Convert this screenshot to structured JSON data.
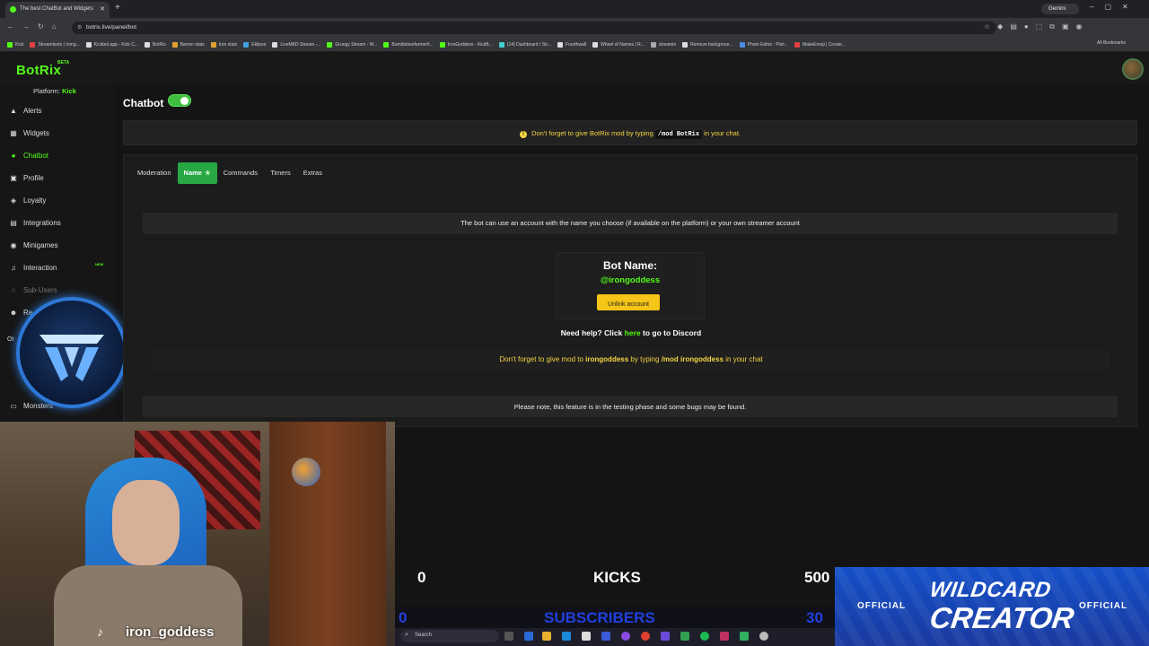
{
  "browser": {
    "tab_title": "The best ChatBot and Widgets",
    "url": "botrix.live/panel/bot",
    "gemini_label": "Gemini",
    "all_bookmarks": "All Bookmarks",
    "bookmarks": [
      "Kick",
      "Streamloots | Irong...",
      "Kickbot.app - Kick C...",
      "BotRix",
      "Barren stats",
      "Iron stats",
      "Eklipse",
      "LiveMKD Stream -...",
      "Grungy Stream - W...",
      "Bumblebeefarmerfi...",
      "IronGoddess - KickB...",
      "(14) Dashboard / Str...",
      "Fourthwall",
      "Wheel of Names | R...",
      "streamin",
      "Remove backgroun...",
      "Photo Editor : Pixlr...",
      "MakeEmoji | Create..."
    ]
  },
  "app": {
    "logo": "BotRix",
    "beta": "BETA",
    "platform_label": "Platform:",
    "platform_value": "Kick"
  },
  "sidebar": {
    "items": [
      {
        "label": "Alerts",
        "icon": "bell-icon"
      },
      {
        "label": "Widgets",
        "icon": "widgets-icon"
      },
      {
        "label": "Chatbot",
        "icon": "chat-icon"
      },
      {
        "label": "Profile",
        "icon": "profile-icon"
      },
      {
        "label": "Loyalty",
        "icon": "loyalty-icon"
      },
      {
        "label": "Integrations",
        "icon": "integrations-icon"
      },
      {
        "label": "Minigames",
        "icon": "gamepad-icon"
      },
      {
        "label": "Interaction",
        "icon": "music-icon"
      },
      {
        "label": "Sub-Users",
        "icon": "users-icon"
      },
      {
        "label": "Re",
        "icon": "referral-icon"
      },
      {
        "label": "Monsters",
        "icon": "monster-icon"
      }
    ],
    "new_badge": "NEW",
    "other_label": "Ot"
  },
  "main": {
    "title": "Chatbot",
    "notice_text_1": "Don't forget to give BotRix mod by typing",
    "notice_cmd": "/mod BotRix",
    "notice_text_2": "in your chat.",
    "tabs": [
      {
        "label": "Moderation"
      },
      {
        "label": "Name"
      },
      {
        "label": "Commands"
      },
      {
        "label": "Timers"
      },
      {
        "label": "Extras"
      }
    ],
    "info_text": "The bot can use an account with the name you choose (if available on the platform) or your own streamer account",
    "bot_name_label": "Bot Name:",
    "bot_name_value": "@irongoddess",
    "unlink_label": "Unlink account",
    "help_text_1": "Need help? Click",
    "help_link": "here",
    "help_text_2": "to go to Discord",
    "mod_text_1": "Don't forget to give mod to",
    "mod_name": "irongoddess",
    "mod_text_2": "by typing",
    "mod_cmd": "/mod irongoddess",
    "mod_text_3": "in your chat",
    "test_notice": "Please note, this feature is in the testing phase and some bugs may be found."
  },
  "stream": {
    "handle": "iron_goddess",
    "kicks_current": "0",
    "kicks_label": "KICKS",
    "kicks_goal": "500",
    "subs_current": "0",
    "subs_label": "SUBSCRIBERS",
    "subs_goal": "30",
    "banner_line1": "WILDCARD",
    "banner_line2": "CREATOR",
    "banner_official_left": "OFFICIAL",
    "banner_official_right": "OFFICIAL",
    "taskbar_search": "Search"
  },
  "colors": {
    "accent": "#53fc18",
    "tab_active": "#27a844",
    "warning": "#f5d442",
    "button_yellow": "#f5c518",
    "sub_blue": "#2040e0"
  }
}
